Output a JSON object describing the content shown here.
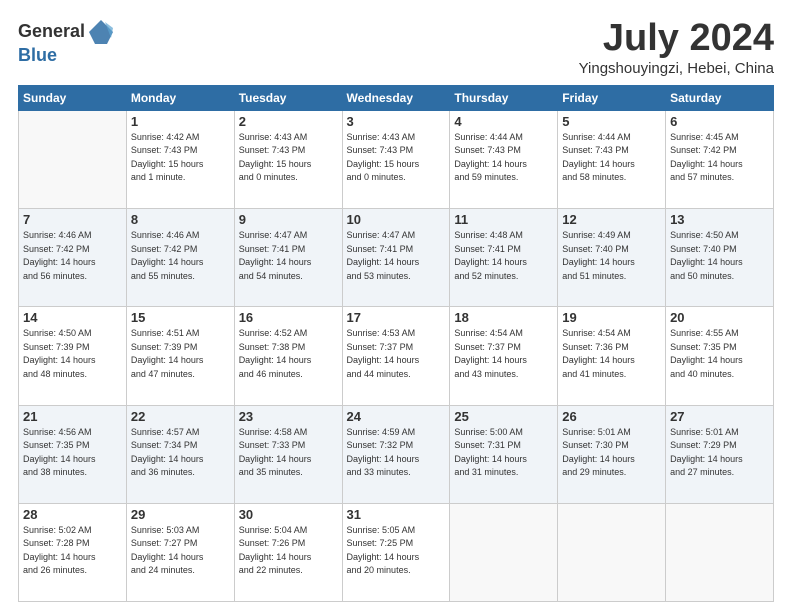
{
  "header": {
    "logo_general": "General",
    "logo_blue": "Blue",
    "month_title": "July 2024",
    "location": "Yingshouyingzi, Hebei, China"
  },
  "days_of_week": [
    "Sunday",
    "Monday",
    "Tuesday",
    "Wednesday",
    "Thursday",
    "Friday",
    "Saturday"
  ],
  "weeks": [
    [
      {
        "day": "",
        "info": ""
      },
      {
        "day": "1",
        "info": "Sunrise: 4:42 AM\nSunset: 7:43 PM\nDaylight: 15 hours\nand 1 minute."
      },
      {
        "day": "2",
        "info": "Sunrise: 4:43 AM\nSunset: 7:43 PM\nDaylight: 15 hours\nand 0 minutes."
      },
      {
        "day": "3",
        "info": "Sunrise: 4:43 AM\nSunset: 7:43 PM\nDaylight: 15 hours\nand 0 minutes."
      },
      {
        "day": "4",
        "info": "Sunrise: 4:44 AM\nSunset: 7:43 PM\nDaylight: 14 hours\nand 59 minutes."
      },
      {
        "day": "5",
        "info": "Sunrise: 4:44 AM\nSunset: 7:43 PM\nDaylight: 14 hours\nand 58 minutes."
      },
      {
        "day": "6",
        "info": "Sunrise: 4:45 AM\nSunset: 7:42 PM\nDaylight: 14 hours\nand 57 minutes."
      }
    ],
    [
      {
        "day": "7",
        "info": "Sunrise: 4:46 AM\nSunset: 7:42 PM\nDaylight: 14 hours\nand 56 minutes."
      },
      {
        "day": "8",
        "info": "Sunrise: 4:46 AM\nSunset: 7:42 PM\nDaylight: 14 hours\nand 55 minutes."
      },
      {
        "day": "9",
        "info": "Sunrise: 4:47 AM\nSunset: 7:41 PM\nDaylight: 14 hours\nand 54 minutes."
      },
      {
        "day": "10",
        "info": "Sunrise: 4:47 AM\nSunset: 7:41 PM\nDaylight: 14 hours\nand 53 minutes."
      },
      {
        "day": "11",
        "info": "Sunrise: 4:48 AM\nSunset: 7:41 PM\nDaylight: 14 hours\nand 52 minutes."
      },
      {
        "day": "12",
        "info": "Sunrise: 4:49 AM\nSunset: 7:40 PM\nDaylight: 14 hours\nand 51 minutes."
      },
      {
        "day": "13",
        "info": "Sunrise: 4:50 AM\nSunset: 7:40 PM\nDaylight: 14 hours\nand 50 minutes."
      }
    ],
    [
      {
        "day": "14",
        "info": "Sunrise: 4:50 AM\nSunset: 7:39 PM\nDaylight: 14 hours\nand 48 minutes."
      },
      {
        "day": "15",
        "info": "Sunrise: 4:51 AM\nSunset: 7:39 PM\nDaylight: 14 hours\nand 47 minutes."
      },
      {
        "day": "16",
        "info": "Sunrise: 4:52 AM\nSunset: 7:38 PM\nDaylight: 14 hours\nand 46 minutes."
      },
      {
        "day": "17",
        "info": "Sunrise: 4:53 AM\nSunset: 7:37 PM\nDaylight: 14 hours\nand 44 minutes."
      },
      {
        "day": "18",
        "info": "Sunrise: 4:54 AM\nSunset: 7:37 PM\nDaylight: 14 hours\nand 43 minutes."
      },
      {
        "day": "19",
        "info": "Sunrise: 4:54 AM\nSunset: 7:36 PM\nDaylight: 14 hours\nand 41 minutes."
      },
      {
        "day": "20",
        "info": "Sunrise: 4:55 AM\nSunset: 7:35 PM\nDaylight: 14 hours\nand 40 minutes."
      }
    ],
    [
      {
        "day": "21",
        "info": "Sunrise: 4:56 AM\nSunset: 7:35 PM\nDaylight: 14 hours\nand 38 minutes."
      },
      {
        "day": "22",
        "info": "Sunrise: 4:57 AM\nSunset: 7:34 PM\nDaylight: 14 hours\nand 36 minutes."
      },
      {
        "day": "23",
        "info": "Sunrise: 4:58 AM\nSunset: 7:33 PM\nDaylight: 14 hours\nand 35 minutes."
      },
      {
        "day": "24",
        "info": "Sunrise: 4:59 AM\nSunset: 7:32 PM\nDaylight: 14 hours\nand 33 minutes."
      },
      {
        "day": "25",
        "info": "Sunrise: 5:00 AM\nSunset: 7:31 PM\nDaylight: 14 hours\nand 31 minutes."
      },
      {
        "day": "26",
        "info": "Sunrise: 5:01 AM\nSunset: 7:30 PM\nDaylight: 14 hours\nand 29 minutes."
      },
      {
        "day": "27",
        "info": "Sunrise: 5:01 AM\nSunset: 7:29 PM\nDaylight: 14 hours\nand 27 minutes."
      }
    ],
    [
      {
        "day": "28",
        "info": "Sunrise: 5:02 AM\nSunset: 7:28 PM\nDaylight: 14 hours\nand 26 minutes."
      },
      {
        "day": "29",
        "info": "Sunrise: 5:03 AM\nSunset: 7:27 PM\nDaylight: 14 hours\nand 24 minutes."
      },
      {
        "day": "30",
        "info": "Sunrise: 5:04 AM\nSunset: 7:26 PM\nDaylight: 14 hours\nand 22 minutes."
      },
      {
        "day": "31",
        "info": "Sunrise: 5:05 AM\nSunset: 7:25 PM\nDaylight: 14 hours\nand 20 minutes."
      },
      {
        "day": "",
        "info": ""
      },
      {
        "day": "",
        "info": ""
      },
      {
        "day": "",
        "info": ""
      }
    ]
  ]
}
